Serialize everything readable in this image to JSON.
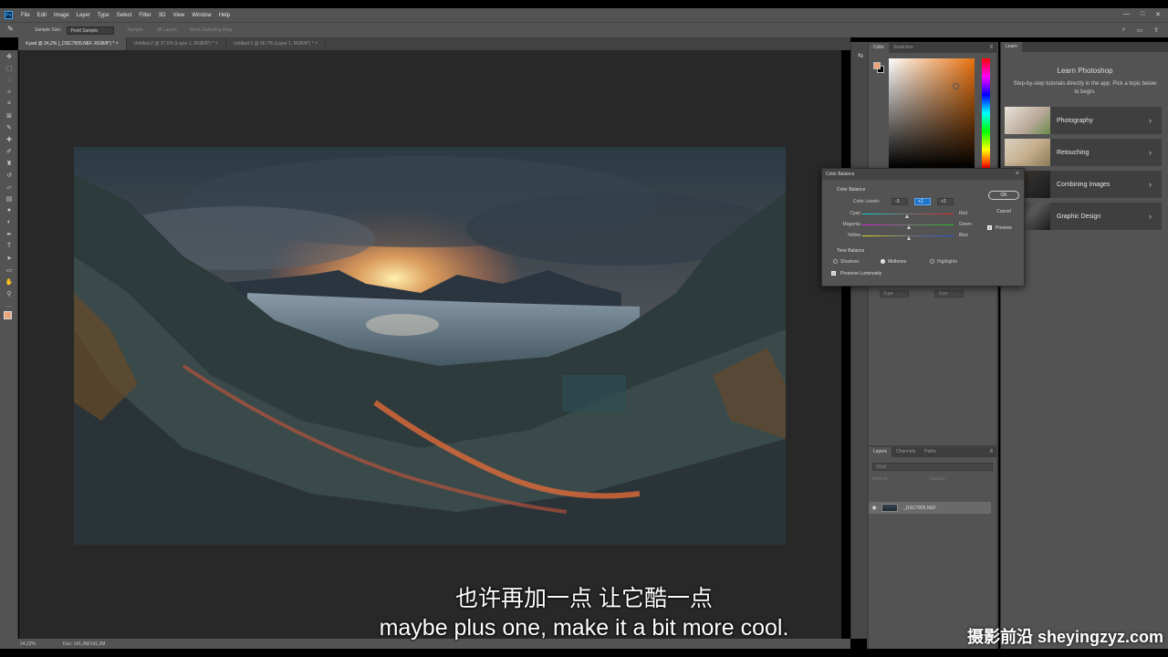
{
  "menubar": {
    "app_logo": "Ps",
    "items": [
      "File",
      "Edit",
      "Image",
      "Layer",
      "Type",
      "Select",
      "Filter",
      "3D",
      "View",
      "Window",
      "Help"
    ],
    "window_controls": [
      "—",
      "□",
      "✕"
    ]
  },
  "options": {
    "sample_size_label": "Sample Size:",
    "sample_size_value": "Point Sample",
    "sample_label": "Sample:",
    "sample_value": "All Layers",
    "show_ring": "Show Sampling Ring"
  },
  "tabs": [
    {
      "label": "4.psd @ 24,2% (_DSC7805.NEF, RGB/8*) *  ×",
      "active": true
    },
    {
      "label": "Untitled-2 @ 37,6% (Layer 1, RGB/8*) *  ×",
      "active": false
    },
    {
      "label": "Untitled-1 @ 66,7% (Layer 1, RGB/8*) *  ×",
      "active": false
    }
  ],
  "status": {
    "zoom": "24,22%",
    "doc": "Doc: 141,2M/141,2M"
  },
  "color_panel": {
    "tabs": [
      "Color",
      "Swatches"
    ],
    "fg_color": "#e8a57a"
  },
  "props_panel": {
    "inputs": [
      "0 px",
      "0 px"
    ]
  },
  "layers_panel": {
    "tabs": [
      "Layers",
      "Channels",
      "Paths"
    ],
    "search_placeholder": "Kind",
    "mode": "Normal",
    "opacity": "Opacity:",
    "layer_name": "_DSC7805.NEF"
  },
  "learn_panel": {
    "tab": "Learn",
    "title": "Learn Photoshop",
    "description": "Step-by-step tutorials directly in the app. Pick a topic below to begin.",
    "cards": [
      "Photography",
      "Retouching",
      "Combining Images",
      "Graphic Design"
    ]
  },
  "dialog": {
    "title": "Color Balance",
    "group_color": "Color Balance",
    "color_levels_label": "Color Levels:",
    "levels": [
      "-3",
      "+1",
      "+2"
    ],
    "sliders": [
      {
        "left": "Cyan",
        "right": "Red",
        "value": -3
      },
      {
        "left": "Magenta",
        "right": "Green",
        "value": 1
      },
      {
        "left": "Yellow",
        "right": "Blue",
        "value": 2
      }
    ],
    "group_tone": "Tone Balance",
    "tones": [
      "Shadows",
      "Midtones",
      "Highlights"
    ],
    "selected_tone": "Midtones",
    "preserve": "Preserve Luminosity",
    "ok": "OK",
    "cancel": "Cancel",
    "preview": "Preview"
  },
  "subtitles": {
    "cn": "也许再加一点 让它酷一点",
    "en": "maybe plus one, make it a bit more cool."
  },
  "watermark": "摄影前沿 sheyingzyz.com"
}
